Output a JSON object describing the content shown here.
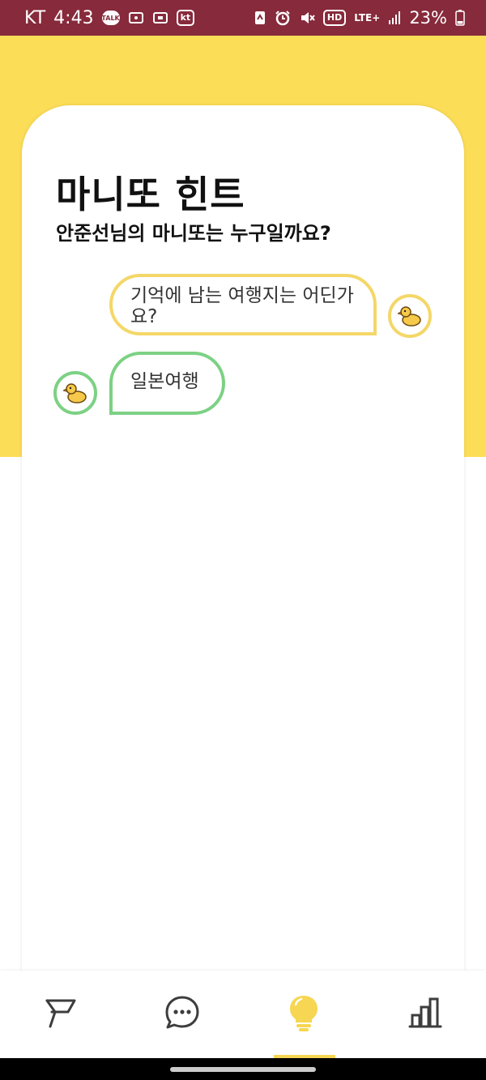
{
  "status_bar": {
    "carrier": "KT",
    "time": "4:43",
    "talk_label": "TALK",
    "kt_label": "kt",
    "hd_label": "HD",
    "network_label": "LTE+",
    "battery_percent": "23%"
  },
  "hint": {
    "title": "마니또 힌트",
    "subtitle": "안준선님의 마니또는 누구일까요?"
  },
  "chat": {
    "question": "기억에 남는 여행지는 어딘가요?",
    "answer": "일본여행",
    "avatar_icon": "duck-icon"
  },
  "bottom_nav": {
    "items": [
      "flag-icon",
      "chat-bubble-icon",
      "lightbulb-icon",
      "bar-chart-icon"
    ],
    "active_index": 2,
    "active_color": "#f6d652",
    "inactive_color": "#3d3d3d"
  },
  "colors": {
    "status_bar": "#872a3b",
    "background_yellow": "#fcdd57",
    "question_border": "#f4d768",
    "answer_border": "#7cd184"
  }
}
